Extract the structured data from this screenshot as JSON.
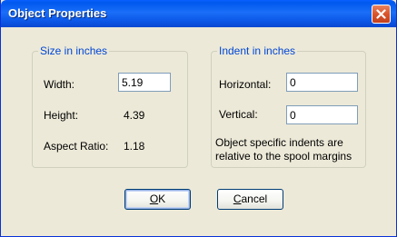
{
  "window": {
    "title": "Object Properties",
    "close_icon": "close-icon"
  },
  "size_group": {
    "legend": "Size in inches",
    "width_label": "Width:",
    "width_value": "5.19",
    "height_label": "Height:",
    "height_value": "4.39",
    "aspect_label": "Aspect Ratio:",
    "aspect_value": "1.18"
  },
  "indent_group": {
    "legend": "Indent in inches",
    "horizontal_label": "Horizontal:",
    "horizontal_value": "0",
    "vertical_label": "Vertical:",
    "vertical_value": "0",
    "note_line1": "Object specific indents are",
    "note_line2": "relative to the spool margins"
  },
  "buttons": {
    "ok_mnemonic": "O",
    "ok_rest": "K",
    "cancel_mnemonic": "C",
    "cancel_rest": "ancel"
  },
  "colors": {
    "titlebar": "#0058ee",
    "group_legend": "#0046d5",
    "dialog_bg": "#ece9d8",
    "close_button": "#d9542c"
  }
}
